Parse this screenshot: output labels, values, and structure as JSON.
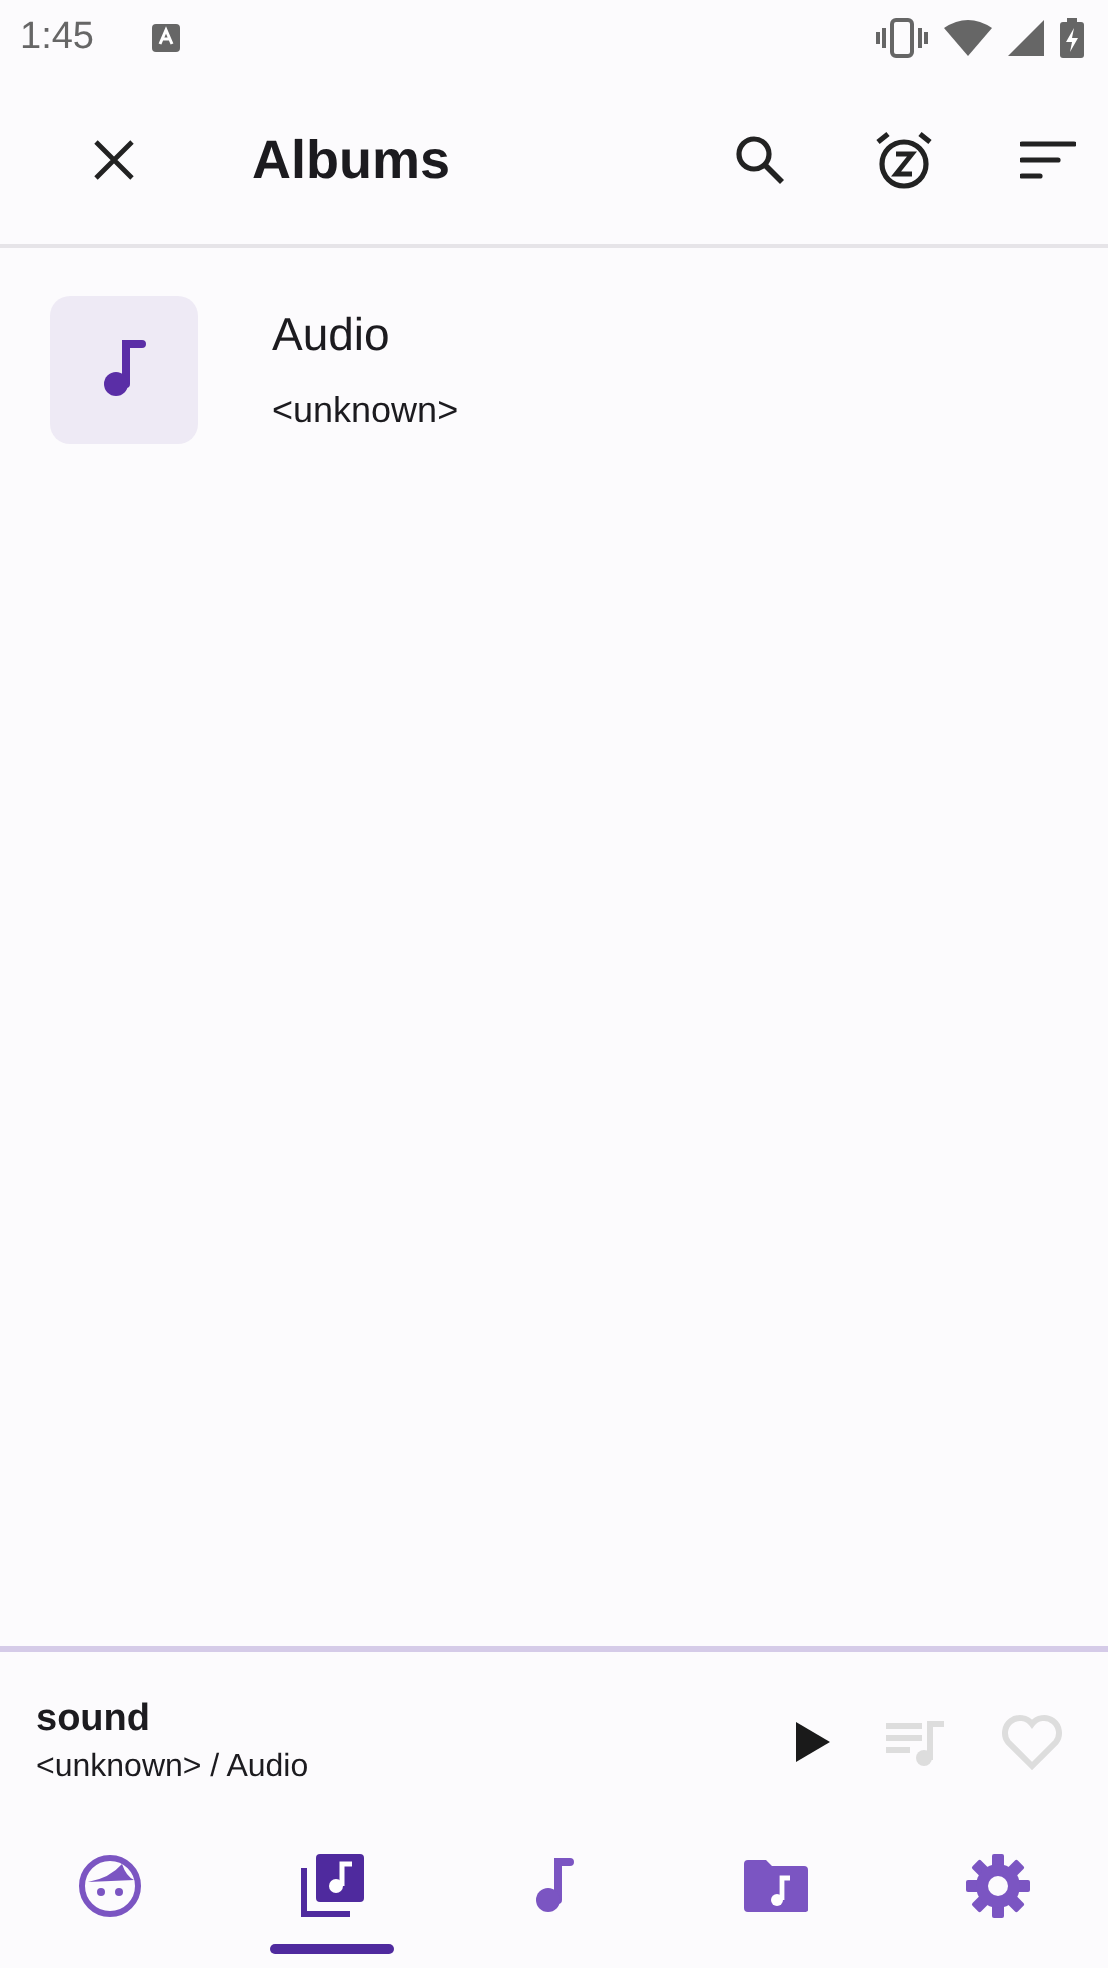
{
  "status_bar": {
    "time": "1:45"
  },
  "toolbar": {
    "title": "Albums"
  },
  "albums": [
    {
      "title": "Audio",
      "artist": "<unknown>"
    }
  ],
  "player": {
    "title": "sound",
    "subtitle": "<unknown> / Audio",
    "favorite": false
  },
  "nav_tabs": [
    {
      "kind": "artists",
      "selected": false
    },
    {
      "kind": "albums",
      "selected": true
    },
    {
      "kind": "songs",
      "selected": false
    },
    {
      "kind": "folders",
      "selected": false
    },
    {
      "kind": "settings",
      "selected": false
    }
  ]
}
